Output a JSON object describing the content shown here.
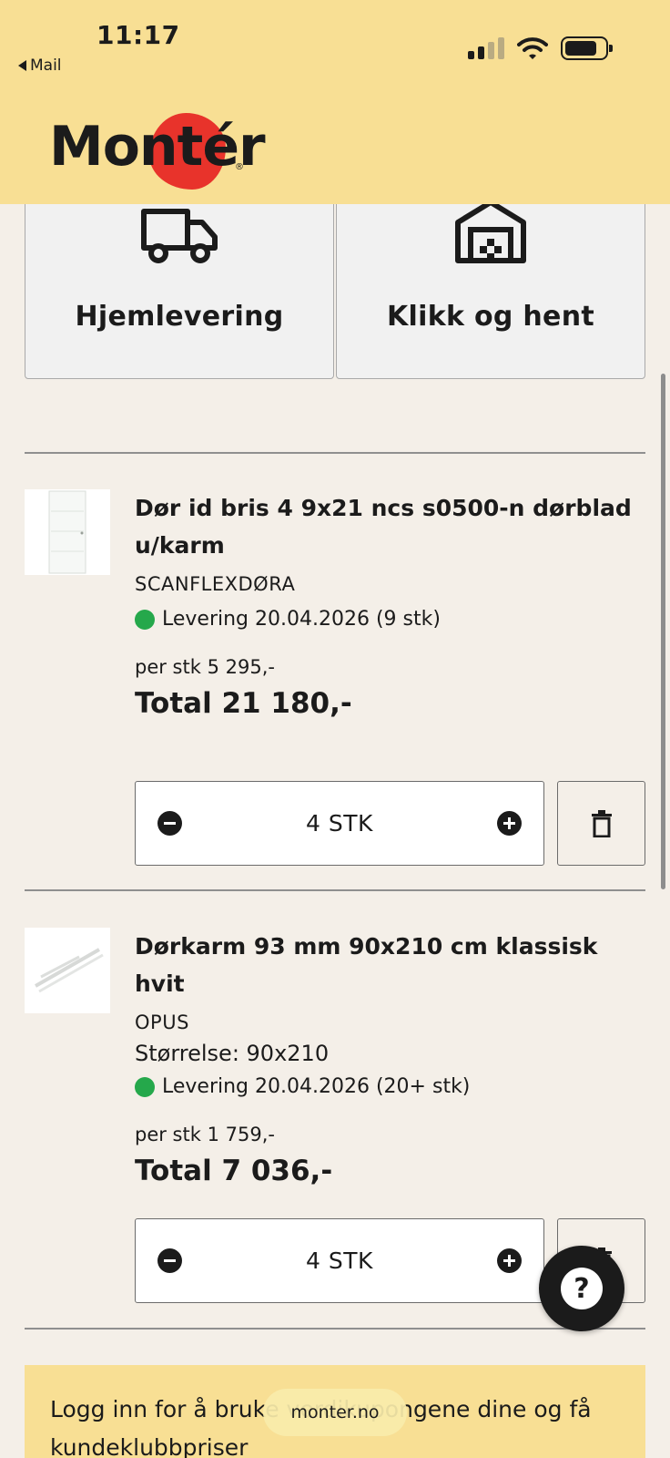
{
  "status_bar": {
    "time": "11:17",
    "back_app": "Mail"
  },
  "brand": {
    "logo_text": "Montér",
    "logo_reg": "®",
    "accent": "#e8332b",
    "header_bg": "#f8df94"
  },
  "delivery_options": [
    {
      "label": "Hjemlevering",
      "icon": "truck-icon"
    },
    {
      "label": "Klikk og hent",
      "icon": "store-icon"
    }
  ],
  "cart": {
    "items": [
      {
        "title": "Dør id bris 4 9x21 ncs s0500-n dørblad u/karm",
        "brand": "SCANFLEXDØRA",
        "size": "",
        "stock": "Levering 20.04.2026 (9 stk)",
        "unit_price": "per stk 5 295,-",
        "total": "Total 21 180,-",
        "quantity": "4 STK"
      },
      {
        "title": "Dørkarm 93 mm 90x210 cm klassisk hvit",
        "brand": "OPUS",
        "size": "Størrelse: 90x210",
        "stock": "Levering 20.04.2026 (20+ stk)",
        "unit_price": "per stk 1 759,-",
        "total": "Total 7 036,-",
        "quantity": "4 STK"
      }
    ]
  },
  "login_banner": {
    "text": "Logg inn for å bruke verdikupongene dine og få kundeklubbpriser"
  },
  "browser": {
    "url": "monter.no"
  },
  "stock_status_color": "#25a84b"
}
